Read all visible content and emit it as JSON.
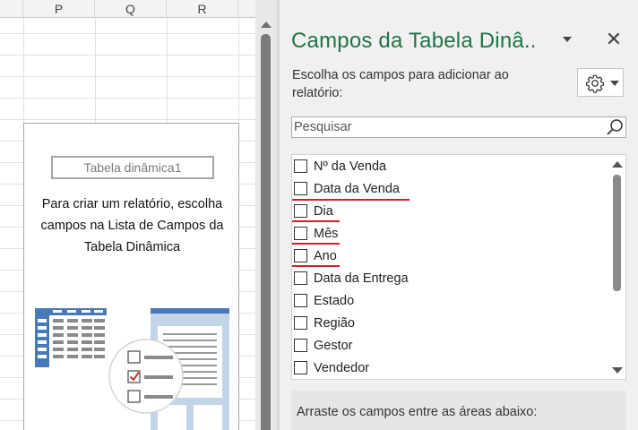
{
  "sheet": {
    "columns": [
      "P",
      "Q",
      "R"
    ],
    "pivot_placeholder": {
      "name": "Tabela dinâmica1",
      "instruction_lines": [
        "Para criar um relatório, escolha",
        "campos na Lista de Campos da",
        "Tabela Dinâmica"
      ]
    }
  },
  "pane": {
    "title": "Campos da Tabela Dinâ..",
    "close_symbol": "✕",
    "choose_fields_label": "Escolha os campos para adicionar ao relatório:",
    "settings_icon": "gear-icon",
    "search": {
      "placeholder": "Pesquisar",
      "value": "",
      "icon": "search-icon"
    },
    "fields": [
      {
        "label": "Nº da Venda",
        "checked": false,
        "underlined": false
      },
      {
        "label": "Data da Venda",
        "checked": false,
        "underlined": true
      },
      {
        "label": "Dia",
        "checked": false,
        "underlined": true
      },
      {
        "label": "Mês",
        "checked": false,
        "underlined": true
      },
      {
        "label": "Ano",
        "checked": false,
        "underlined": true
      },
      {
        "label": "Data da Entrega",
        "checked": false,
        "underlined": false
      },
      {
        "label": "Estado",
        "checked": false,
        "underlined": false
      },
      {
        "label": "Região",
        "checked": false,
        "underlined": false
      },
      {
        "label": "Gestor",
        "checked": false,
        "underlined": false
      },
      {
        "label": "Vendedor",
        "checked": false,
        "underlined": false
      }
    ],
    "drag_fields_label": "Arraste os campos entre as áreas abaixo:"
  },
  "colors": {
    "title_green": "#217346",
    "annotation_red": "#d01f25",
    "illustration_blue": "#4a7ab5"
  }
}
